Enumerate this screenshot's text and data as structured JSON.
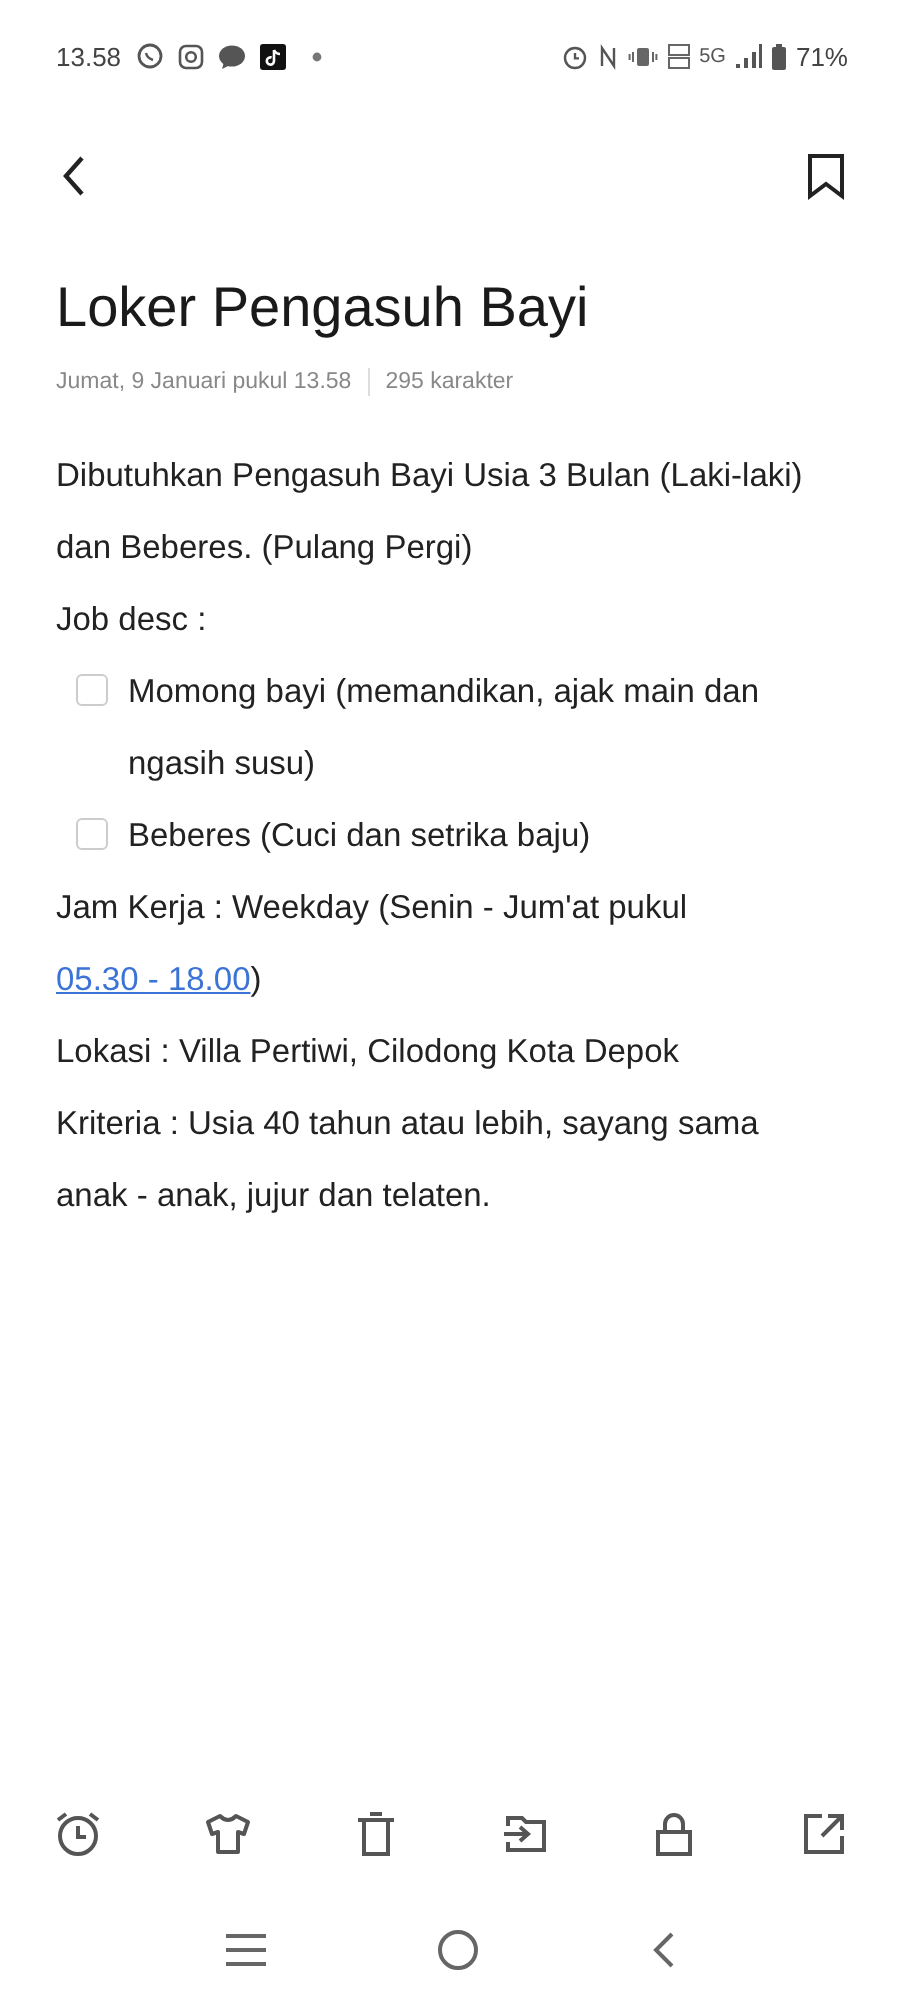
{
  "status_bar": {
    "time": "13.58",
    "network": "5G",
    "battery": "71%"
  },
  "note": {
    "title": "Loker Pengasuh Bayi",
    "date": "Jumat, 9 Januari pukul 13.58",
    "char_count": "295 karakter",
    "body": [
      {
        "kind": "text",
        "text": "Dibutuhkan Pengasuh Bayi Usia 3 Bulan (Laki-laki) dan Beberes. (Pulang Pergi)"
      },
      {
        "kind": "text",
        "text": "Job desc :"
      },
      {
        "kind": "checkbox",
        "text": "Momong bayi (memandikan, ajak main dan ngasih susu)",
        "checked": false
      },
      {
        "kind": "checkbox",
        "text": "Beberes (Cuci dan setrika baju)",
        "checked": false
      },
      {
        "kind": "link_text",
        "text": "Jam Kerja : Weekday (Senin - Jum'at pukul",
        "link": "05.30 - 18.00",
        "after": ")"
      },
      {
        "kind": "text",
        "text": "Lokasi : Villa Pertiwi, Cilodong Kota Depok"
      },
      {
        "kind": "text",
        "text": "Kriteria : Usia 40 tahun atau lebih, sayang sama anak - anak, jujur dan telaten."
      }
    ]
  }
}
